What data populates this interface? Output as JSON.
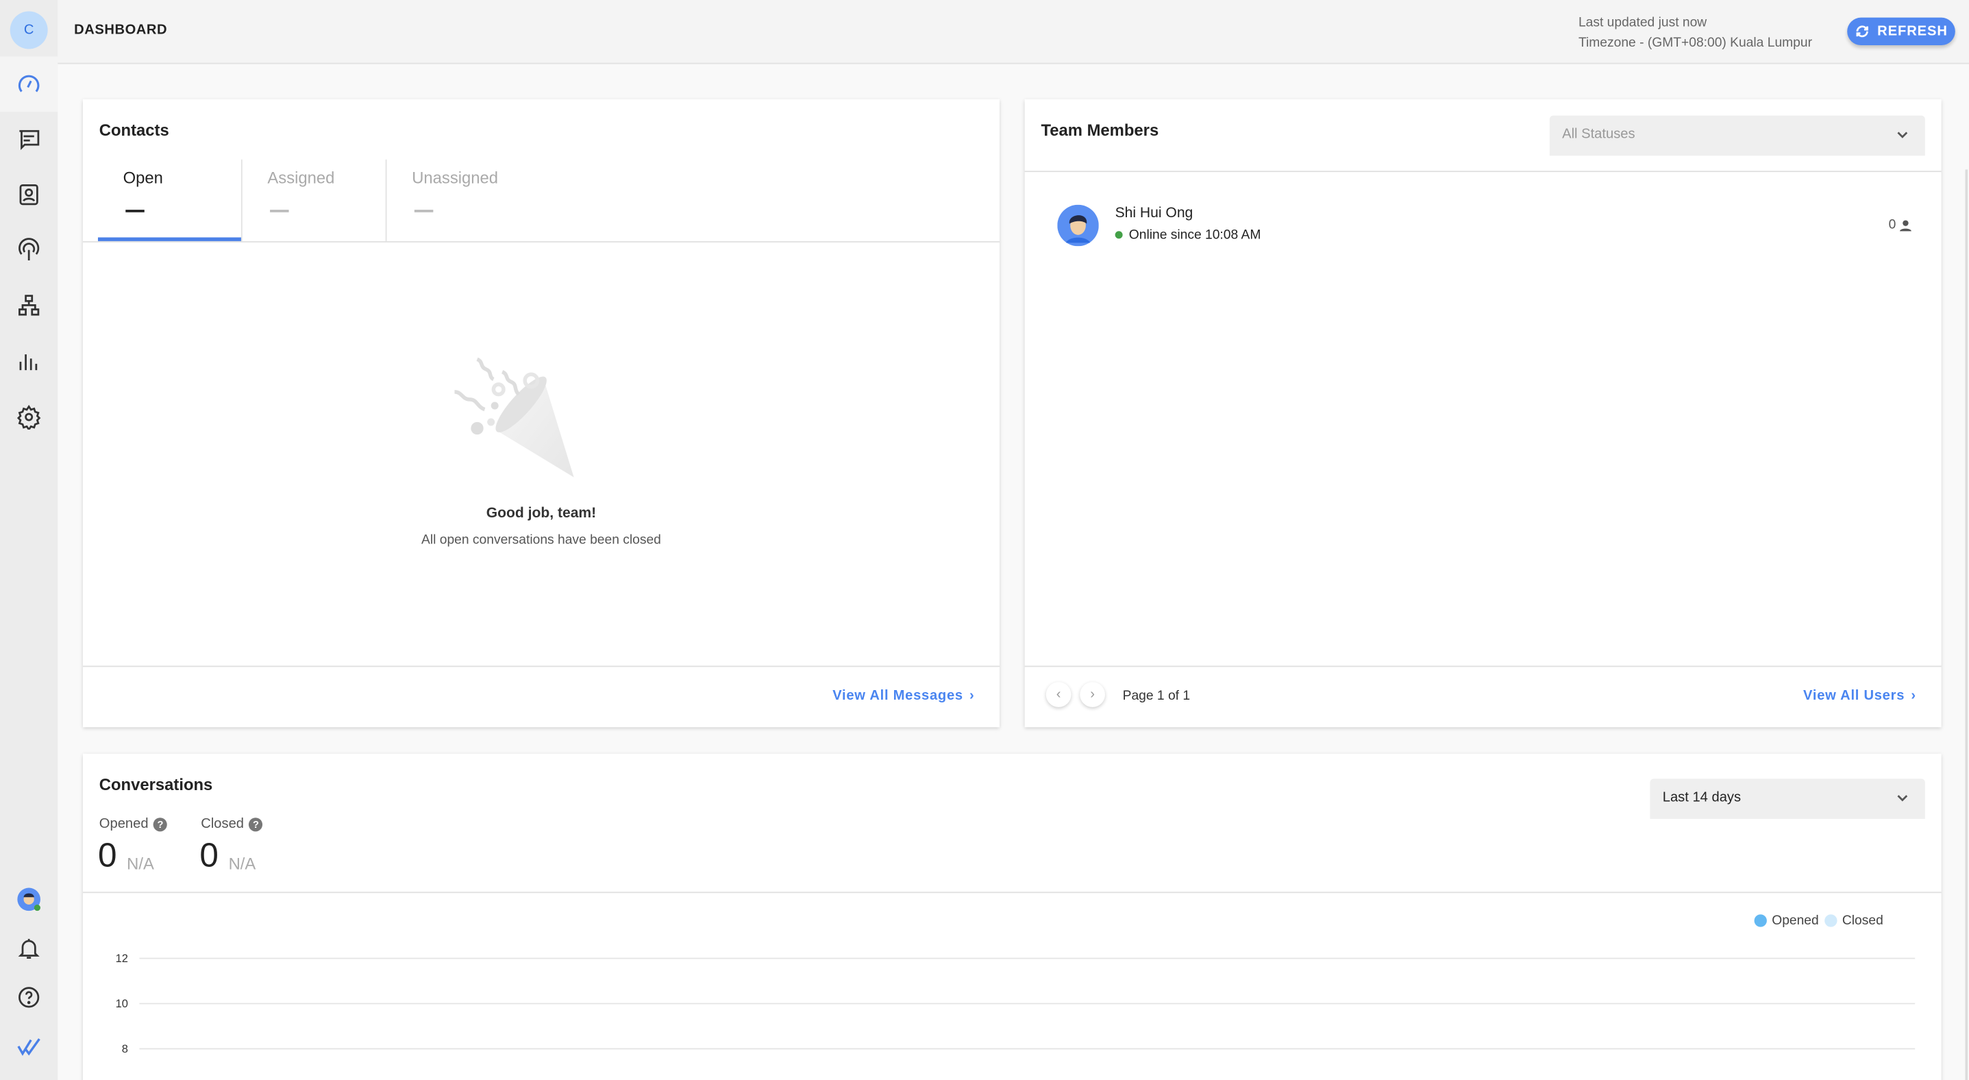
{
  "sidebar": {
    "logo_letter": "C",
    "items": [
      "dashboard",
      "messages",
      "contacts",
      "broadcasts",
      "workflows",
      "reports",
      "settings"
    ],
    "bottom": [
      "user-avatar",
      "notifications",
      "help",
      "brand-logo"
    ]
  },
  "header": {
    "title": "DASHBOARD",
    "last_updated": "Last updated just now",
    "timezone": "Timezone - (GMT+08:00) Kuala Lumpur",
    "refresh_label": "REFRESH"
  },
  "contacts": {
    "title": "Contacts",
    "tabs": [
      {
        "label": "Open",
        "active": true
      },
      {
        "label": "Assigned",
        "active": false
      },
      {
        "label": "Unassigned",
        "active": false
      }
    ],
    "empty_title": "Good job, team!",
    "empty_text": "All open conversations have been closed",
    "view_all": "View All Messages"
  },
  "team": {
    "title": "Team Members",
    "status_filter": "All Statuses",
    "members": [
      {
        "name": "Shi Hui Ong",
        "status": "Online since 10:08 AM",
        "count": "0"
      }
    ],
    "page_text": "Page 1 of 1",
    "view_all": "View All Users"
  },
  "conversations": {
    "title": "Conversations",
    "range": "Last 14 days",
    "opened_label": "Opened",
    "opened_value": "0",
    "opened_change": "N/A",
    "closed_label": "Closed",
    "closed_value": "0",
    "closed_change": "N/A"
  },
  "colors": {
    "accent": "#5188f0",
    "opened": "#63b8f2",
    "closed": "#d1eafb",
    "online": "#43a047"
  },
  "chart_data": {
    "type": "bar",
    "title": "",
    "legend": [
      "Opened",
      "Closed"
    ],
    "legend_position": "top-right",
    "series": [
      {
        "name": "Opened",
        "values": []
      },
      {
        "name": "Closed",
        "values": []
      }
    ],
    "yticks": [
      12,
      10,
      8
    ],
    "ylim_visible": [
      8,
      12
    ],
    "grid": true
  }
}
